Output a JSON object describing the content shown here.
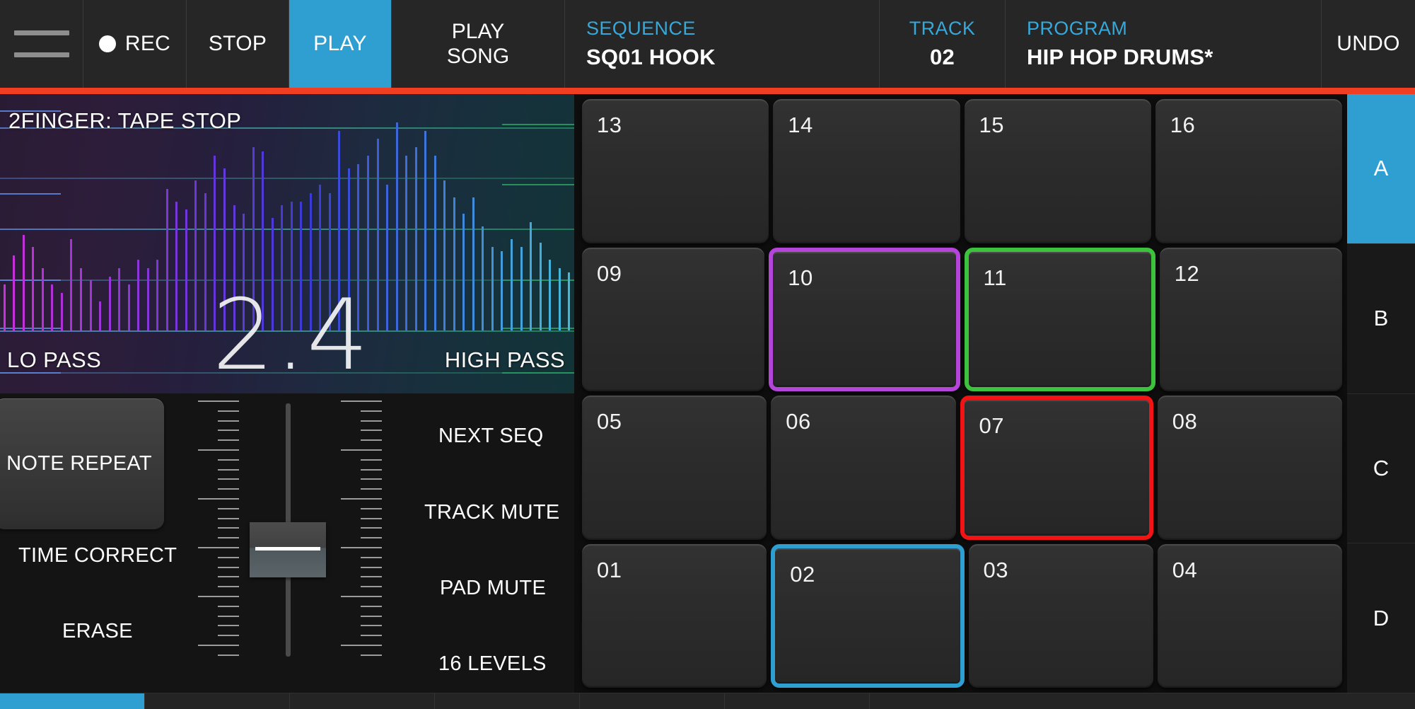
{
  "colors": {
    "accent_blue": "#2e9fd0",
    "accent_orange": "#f03e23",
    "pad_purple": "#b churches"
  },
  "topbar": {
    "menu_icon": "hamburger-icon",
    "rec": {
      "label": "REC",
      "icon": "record-dot-icon"
    },
    "stop": {
      "label": "STOP"
    },
    "play": {
      "label": "PLAY",
      "active": true
    },
    "play_song": {
      "label_line1": "PLAY",
      "label_line2": "SONG"
    },
    "sequence": {
      "caption": "SEQUENCE",
      "value": "SQ01 HOOK"
    },
    "track": {
      "caption": "TRACK",
      "value": "02"
    },
    "program": {
      "caption": "PROGRAM",
      "value": "HIP HOP DRUMS*"
    },
    "undo": {
      "label": "UNDO"
    }
  },
  "xypad": {
    "title": "2FINGER: TAPE STOP",
    "value": "2.4",
    "left_label": "LO PASS",
    "right_label": "HIGH PASS"
  },
  "controls": {
    "note_repeat": "NOTE REPEAT",
    "time_correct": "TIME CORRECT",
    "erase": "ERASE",
    "next_seq": "NEXT SEQ",
    "track_mute": "TRACK MUTE",
    "pad_mute": "PAD MUTE",
    "sixteen_levels": "16 LEVELS"
  },
  "pads": {
    "rows": [
      [
        {
          "num": "13",
          "highlight": null
        },
        {
          "num": "14",
          "highlight": null
        },
        {
          "num": "15",
          "highlight": null
        },
        {
          "num": "16",
          "highlight": null
        }
      ],
      [
        {
          "num": "09",
          "highlight": null
        },
        {
          "num": "10",
          "highlight": "#b545d8"
        },
        {
          "num": "11",
          "highlight": "#3cc23c"
        },
        {
          "num": "12",
          "highlight": null
        }
      ],
      [
        {
          "num": "05",
          "highlight": null
        },
        {
          "num": "06",
          "highlight": null
        },
        {
          "num": "07",
          "highlight": "#f21414"
        },
        {
          "num": "08",
          "highlight": null
        }
      ],
      [
        {
          "num": "01",
          "highlight": null
        },
        {
          "num": "02",
          "highlight": "#2e9fd0"
        },
        {
          "num": "03",
          "highlight": null
        },
        {
          "num": "04",
          "highlight": null
        }
      ]
    ]
  },
  "banks": [
    {
      "label": "A",
      "active": true
    },
    {
      "label": "B",
      "active": false
    },
    {
      "label": "C",
      "active": false
    },
    {
      "label": "D",
      "active": false
    }
  ],
  "tabbar": {
    "count": 7,
    "active_index": 0
  },
  "chart_data": {
    "type": "bar",
    "title": "2FINGER: TAPE STOP filter spectrum",
    "xlabel": "LO PASS → HIGH PASS",
    "ylabel": "",
    "grid": true,
    "values": [
      22,
      36,
      46,
      40,
      30,
      22,
      18,
      44,
      30,
      24,
      14,
      26,
      30,
      22,
      34,
      30,
      34,
      68,
      62,
      58,
      72,
      66,
      84,
      78,
      60,
      56,
      88,
      86,
      54,
      60,
      62,
      62,
      66,
      70,
      66,
      96,
      78,
      80,
      84,
      92,
      70,
      100,
      84,
      88,
      96,
      84,
      72,
      64,
      56,
      64,
      50,
      40,
      38,
      44,
      40,
      52,
      42,
      34,
      30,
      28
    ],
    "gridlines_y": [
      0.11,
      0.28,
      0.45,
      0.62,
      0.79,
      0.93
    ]
  }
}
